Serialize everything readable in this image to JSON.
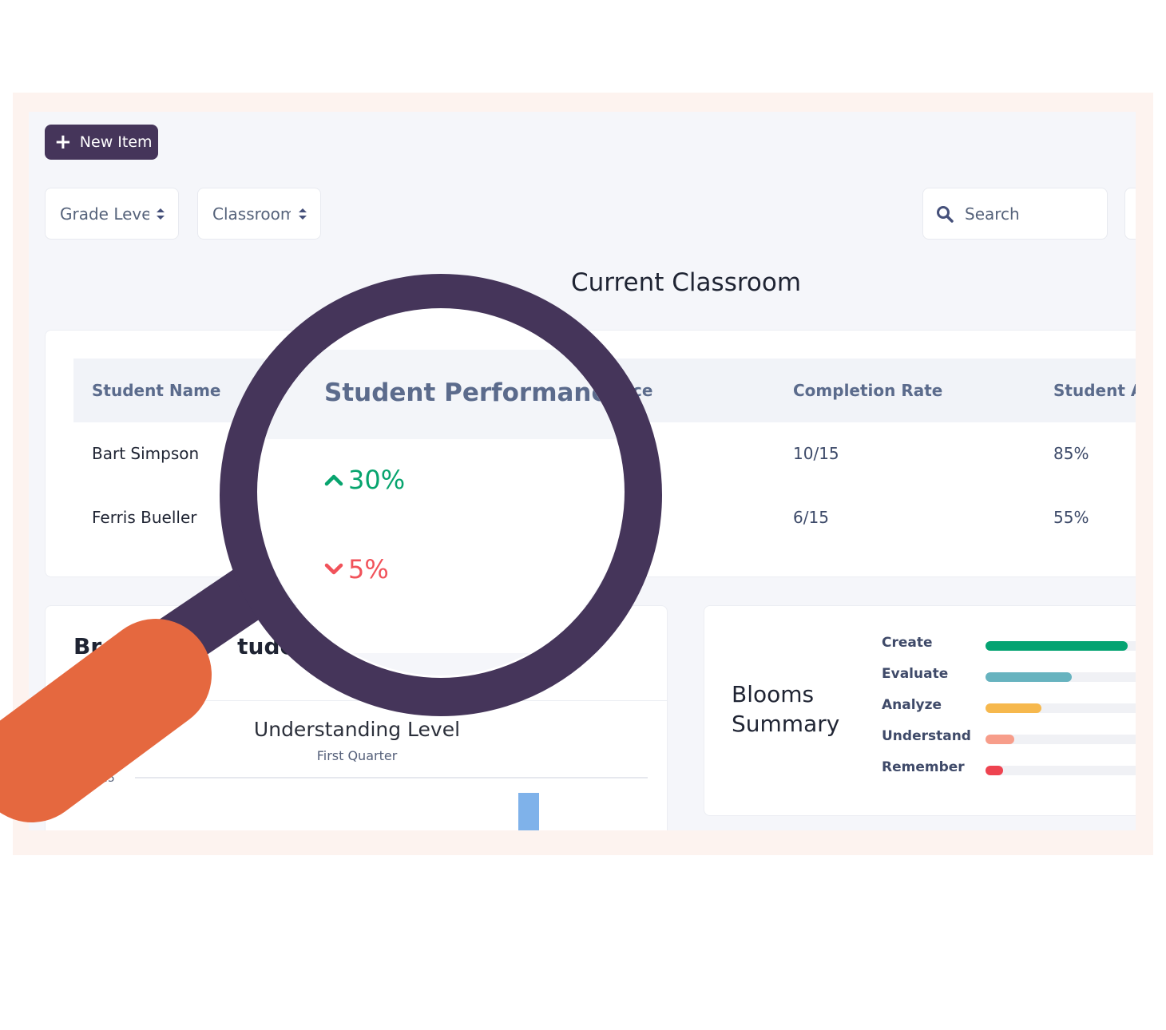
{
  "toolbar": {
    "new_item_label": "New Item"
  },
  "filters": {
    "grade_level": "Grade Level",
    "classroom": "Classroom",
    "search_placeholder": "Search"
  },
  "section_title": "Current Classroom",
  "table": {
    "headers": {
      "student_name": "Student Name",
      "student_performance_partial": "ce",
      "completion_rate": "Completion Rate",
      "student_a": "Student A"
    },
    "rows": [
      {
        "name": "Bart Simpson",
        "completion": "10/15",
        "student_a": "85%"
      },
      {
        "name": "Ferris Bueller",
        "completion": "6/15",
        "student_a": "55%"
      }
    ]
  },
  "magnifier": {
    "header": "Student Performance",
    "values": [
      {
        "text": "30%",
        "direction": "up",
        "color": "#07a46e"
      },
      {
        "text": "5%",
        "direction": "down",
        "color": "#f1525a"
      }
    ]
  },
  "chart_card": {
    "heading_left": "Br",
    "heading_right": "tude",
    "title": "Understanding Level",
    "subtitle": "First Quarter",
    "ytick": "125"
  },
  "chart_data": {
    "type": "bar",
    "title": "Understanding Level",
    "subtitle": "First Quarter",
    "y_ticks": [
      125
    ],
    "visible_bar_value": 120
  },
  "blooms": {
    "title_line1": "Blooms",
    "title_line2": "Summary",
    "items": [
      {
        "label": "Create",
        "value": 0.74,
        "color": "#05a372"
      },
      {
        "label": "Evaluate",
        "value": 0.45,
        "color": "#67b3bf"
      },
      {
        "label": "Analyze",
        "value": 0.29,
        "color": "#f6b84d"
      },
      {
        "label": "Understand",
        "value": 0.15,
        "color": "#f79d8a"
      },
      {
        "label": "Remember",
        "value": 0.09,
        "color": "#ee4350"
      }
    ]
  },
  "colors": {
    "brand": "#45355a",
    "handle": "#e5683f",
    "background": "#f5f6fa"
  }
}
